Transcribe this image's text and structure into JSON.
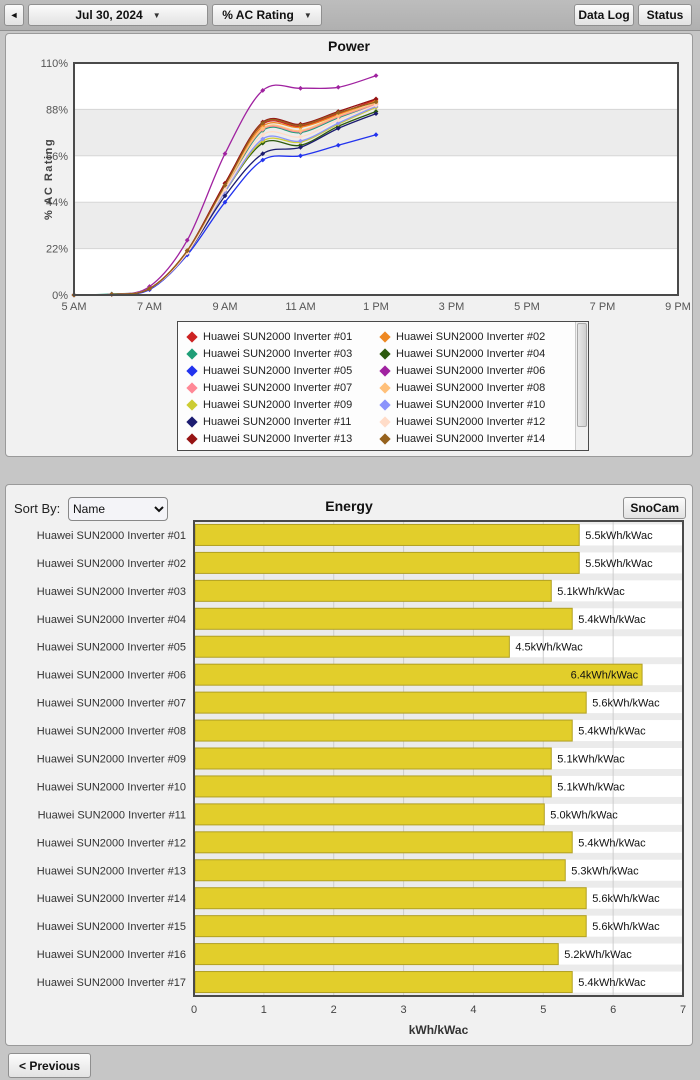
{
  "toolbar": {
    "back_icon": "◄",
    "date_label": "Jul 30, 2024",
    "metric_label": "% AC Rating",
    "dropdown_icon": "▼",
    "data_log_label": "Data Log",
    "status_label": "Status"
  },
  "energy_header": {
    "sort_by_label": "Sort By:",
    "sort_value": "Name",
    "snocam_label": "SnoCam"
  },
  "previous_label": "< Previous",
  "colors": {
    "bar_fill": "#e2ce2b",
    "bar_stroke": "#b1a022",
    "plot_border": "#4a4a4a",
    "band_gray": "#ececec",
    "gridline": "#d6d6d6",
    "tick_text": "#555555"
  },
  "chart_data": [
    {
      "type": "line",
      "title": "Power",
      "ylabel": "% AC Rating",
      "ylim": [
        0,
        110
      ],
      "xlim_hours": [
        5,
        21
      ],
      "y_ticks": [
        {
          "v": 0,
          "label": "0%"
        },
        {
          "v": 22,
          "label": "22%"
        },
        {
          "v": 44,
          "label": "44%"
        },
        {
          "v": 66,
          "label": "66%"
        },
        {
          "v": 88,
          "label": "88%"
        },
        {
          "v": 110,
          "label": "110%"
        }
      ],
      "x_ticks": [
        {
          "h": 5,
          "label": "5 AM"
        },
        {
          "h": 7,
          "label": "7 AM"
        },
        {
          "h": 9,
          "label": "9 AM"
        },
        {
          "h": 11,
          "label": "11 AM"
        },
        {
          "h": 13,
          "label": "1 PM"
        },
        {
          "h": 15,
          "label": "3 PM"
        },
        {
          "h": 17,
          "label": "5 PM"
        },
        {
          "h": 19,
          "label": "7 PM"
        },
        {
          "h": 21,
          "label": "9 PM"
        }
      ],
      "x_hours": [
        5,
        6,
        7,
        8,
        9,
        10,
        11,
        12,
        13
      ],
      "series": [
        {
          "name": "Huawei SUN2000 Inverter #01",
          "color": "#cc2222",
          "values": [
            0,
            0.3,
            3,
            21,
            53,
            81,
            80,
            86,
            92.5
          ]
        },
        {
          "name": "Huawei SUN2000 Inverter #02",
          "color": "#ee8822",
          "values": [
            0,
            0.3,
            3,
            21,
            52,
            80,
            79.5,
            85.5,
            92
          ]
        },
        {
          "name": "Huawei SUN2000 Inverter #03",
          "color": "#1f9e77",
          "values": [
            0,
            0.5,
            3,
            20,
            50,
            78,
            77,
            84,
            90.5
          ]
        },
        {
          "name": "Huawei SUN2000 Inverter #04",
          "color": "#2d5a0e",
          "values": [
            0,
            0.3,
            3,
            20,
            49,
            72,
            71,
            80,
            87
          ]
        },
        {
          "name": "Huawei SUN2000 Inverter #05",
          "color": "#2233ee",
          "values": [
            0,
            0.3,
            2.5,
            19,
            44,
            64,
            66,
            71,
            76
          ]
        },
        {
          "name": "Huawei SUN2000 Inverter #06",
          "color": "#a022a0",
          "values": [
            0,
            0.3,
            4,
            26,
            67,
            97,
            98,
            98.5,
            104
          ]
        },
        {
          "name": "Huawei SUN2000 Inverter #07",
          "color": "#ff8896",
          "values": [
            0,
            0.3,
            3,
            20,
            51,
            78.5,
            77.5,
            84.5,
            90.5
          ]
        },
        {
          "name": "Huawei SUN2000 Inverter #08",
          "color": "#ffc07a",
          "values": [
            0,
            0.3,
            3,
            20,
            51,
            79,
            78,
            85,
            91
          ]
        },
        {
          "name": "Huawei SUN2000 Inverter #09",
          "color": "#cccc33",
          "values": [
            0,
            0.3,
            3,
            20,
            49,
            73,
            72.5,
            81,
            89
          ]
        },
        {
          "name": "Huawei SUN2000 Inverter #10",
          "color": "#8b93fb",
          "values": [
            0,
            0.3,
            3,
            20,
            49,
            74,
            73,
            81.5,
            89.5
          ]
        },
        {
          "name": "Huawei SUN2000 Inverter #11",
          "color": "#1c1c70",
          "values": [
            0,
            0.3,
            3,
            20,
            47,
            67,
            70,
            79,
            86
          ]
        },
        {
          "name": "Huawei SUN2000 Inverter #12",
          "color": "#ffdcc8",
          "values": [
            0,
            0.3,
            3,
            20,
            50,
            76,
            75,
            83,
            90
          ]
        },
        {
          "name": "Huawei SUN2000 Inverter #13",
          "color": "#961313",
          "values": [
            0,
            0.3,
            3,
            21,
            53,
            82,
            81,
            87,
            93
          ]
        },
        {
          "name": "Huawei SUN2000 Inverter #14",
          "color": "#96621d",
          "values": [
            0,
            0.3,
            3,
            21,
            52,
            81.5,
            80.5,
            86.5,
            91.5
          ]
        }
      ]
    },
    {
      "type": "bar",
      "title": "Energy",
      "xlabel": "kWh/kWac",
      "xlim": [
        0,
        7
      ],
      "x_ticks": [
        "0",
        "1",
        "2",
        "3",
        "4",
        "5",
        "6",
        "7"
      ],
      "categories": [
        "Huawei SUN2000 Inverter #01",
        "Huawei SUN2000 Inverter #02",
        "Huawei SUN2000 Inverter #03",
        "Huawei SUN2000 Inverter #04",
        "Huawei SUN2000 Inverter #05",
        "Huawei SUN2000 Inverter #06",
        "Huawei SUN2000 Inverter #07",
        "Huawei SUN2000 Inverter #08",
        "Huawei SUN2000 Inverter #09",
        "Huawei SUN2000 Inverter #10",
        "Huawei SUN2000 Inverter #11",
        "Huawei SUN2000 Inverter #12",
        "Huawei SUN2000 Inverter #13",
        "Huawei SUN2000 Inverter #14",
        "Huawei SUN2000 Inverter #15",
        "Huawei SUN2000 Inverter #16",
        "Huawei SUN2000 Inverter #17"
      ],
      "values": [
        5.5,
        5.5,
        5.1,
        5.4,
        4.5,
        6.4,
        5.6,
        5.4,
        5.1,
        5.1,
        5.0,
        5.4,
        5.3,
        5.6,
        5.6,
        5.2,
        5.4
      ],
      "value_labels": [
        "5.5kWh/kWac",
        "5.5kWh/kWac",
        "5.1kWh/kWac",
        "5.4kWh/kWac",
        "4.5kWh/kWac",
        "6.4kWh/kWac",
        "5.6kWh/kWac",
        "5.4kWh/kWac",
        "5.1kWh/kWac",
        "5.1kWh/kWac",
        "5.0kWh/kWac",
        "5.4kWh/kWac",
        "5.3kWh/kWac",
        "5.6kWh/kWac",
        "5.6kWh/kWac",
        "5.2kWh/kWac",
        "5.4kWh/kWac"
      ]
    }
  ]
}
